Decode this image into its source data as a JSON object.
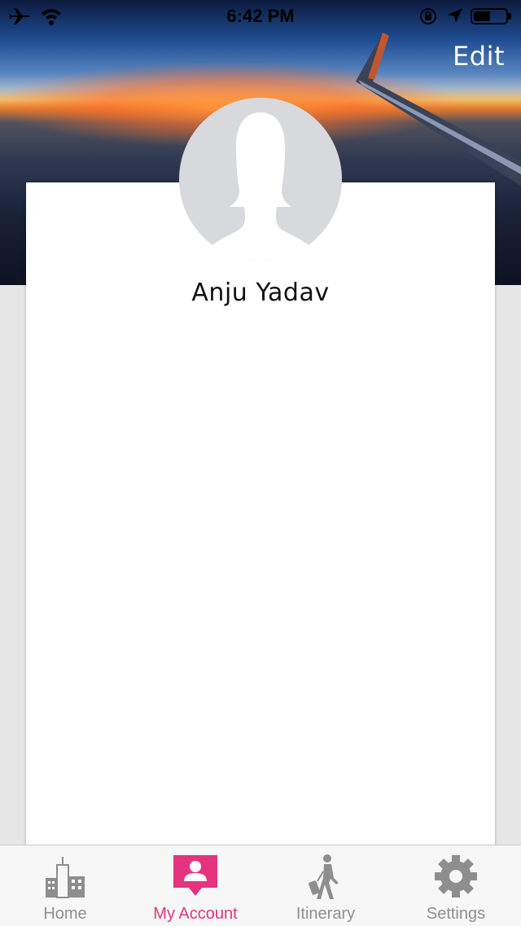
{
  "status_bar": {
    "time": "6:42 PM",
    "icons": [
      "airplane-icon",
      "wifi-icon",
      "orientation-lock-icon",
      "location-icon",
      "battery-icon"
    ]
  },
  "header": {
    "edit_label": "Edit"
  },
  "profile": {
    "name": "Anju Yadav"
  },
  "tabbar": {
    "tabs": [
      {
        "label": "Home",
        "icon": "city-icon",
        "active": false
      },
      {
        "label": "My Account",
        "icon": "account-icon",
        "active": true
      },
      {
        "label": "Itinerary",
        "icon": "traveler-icon",
        "active": false
      },
      {
        "label": "Settings",
        "icon": "gear-icon",
        "active": false
      }
    ]
  },
  "colors": {
    "accent": "#e5337f",
    "inactive_tab": "#8e8e8e",
    "page_bg": "#e6e6e6"
  }
}
